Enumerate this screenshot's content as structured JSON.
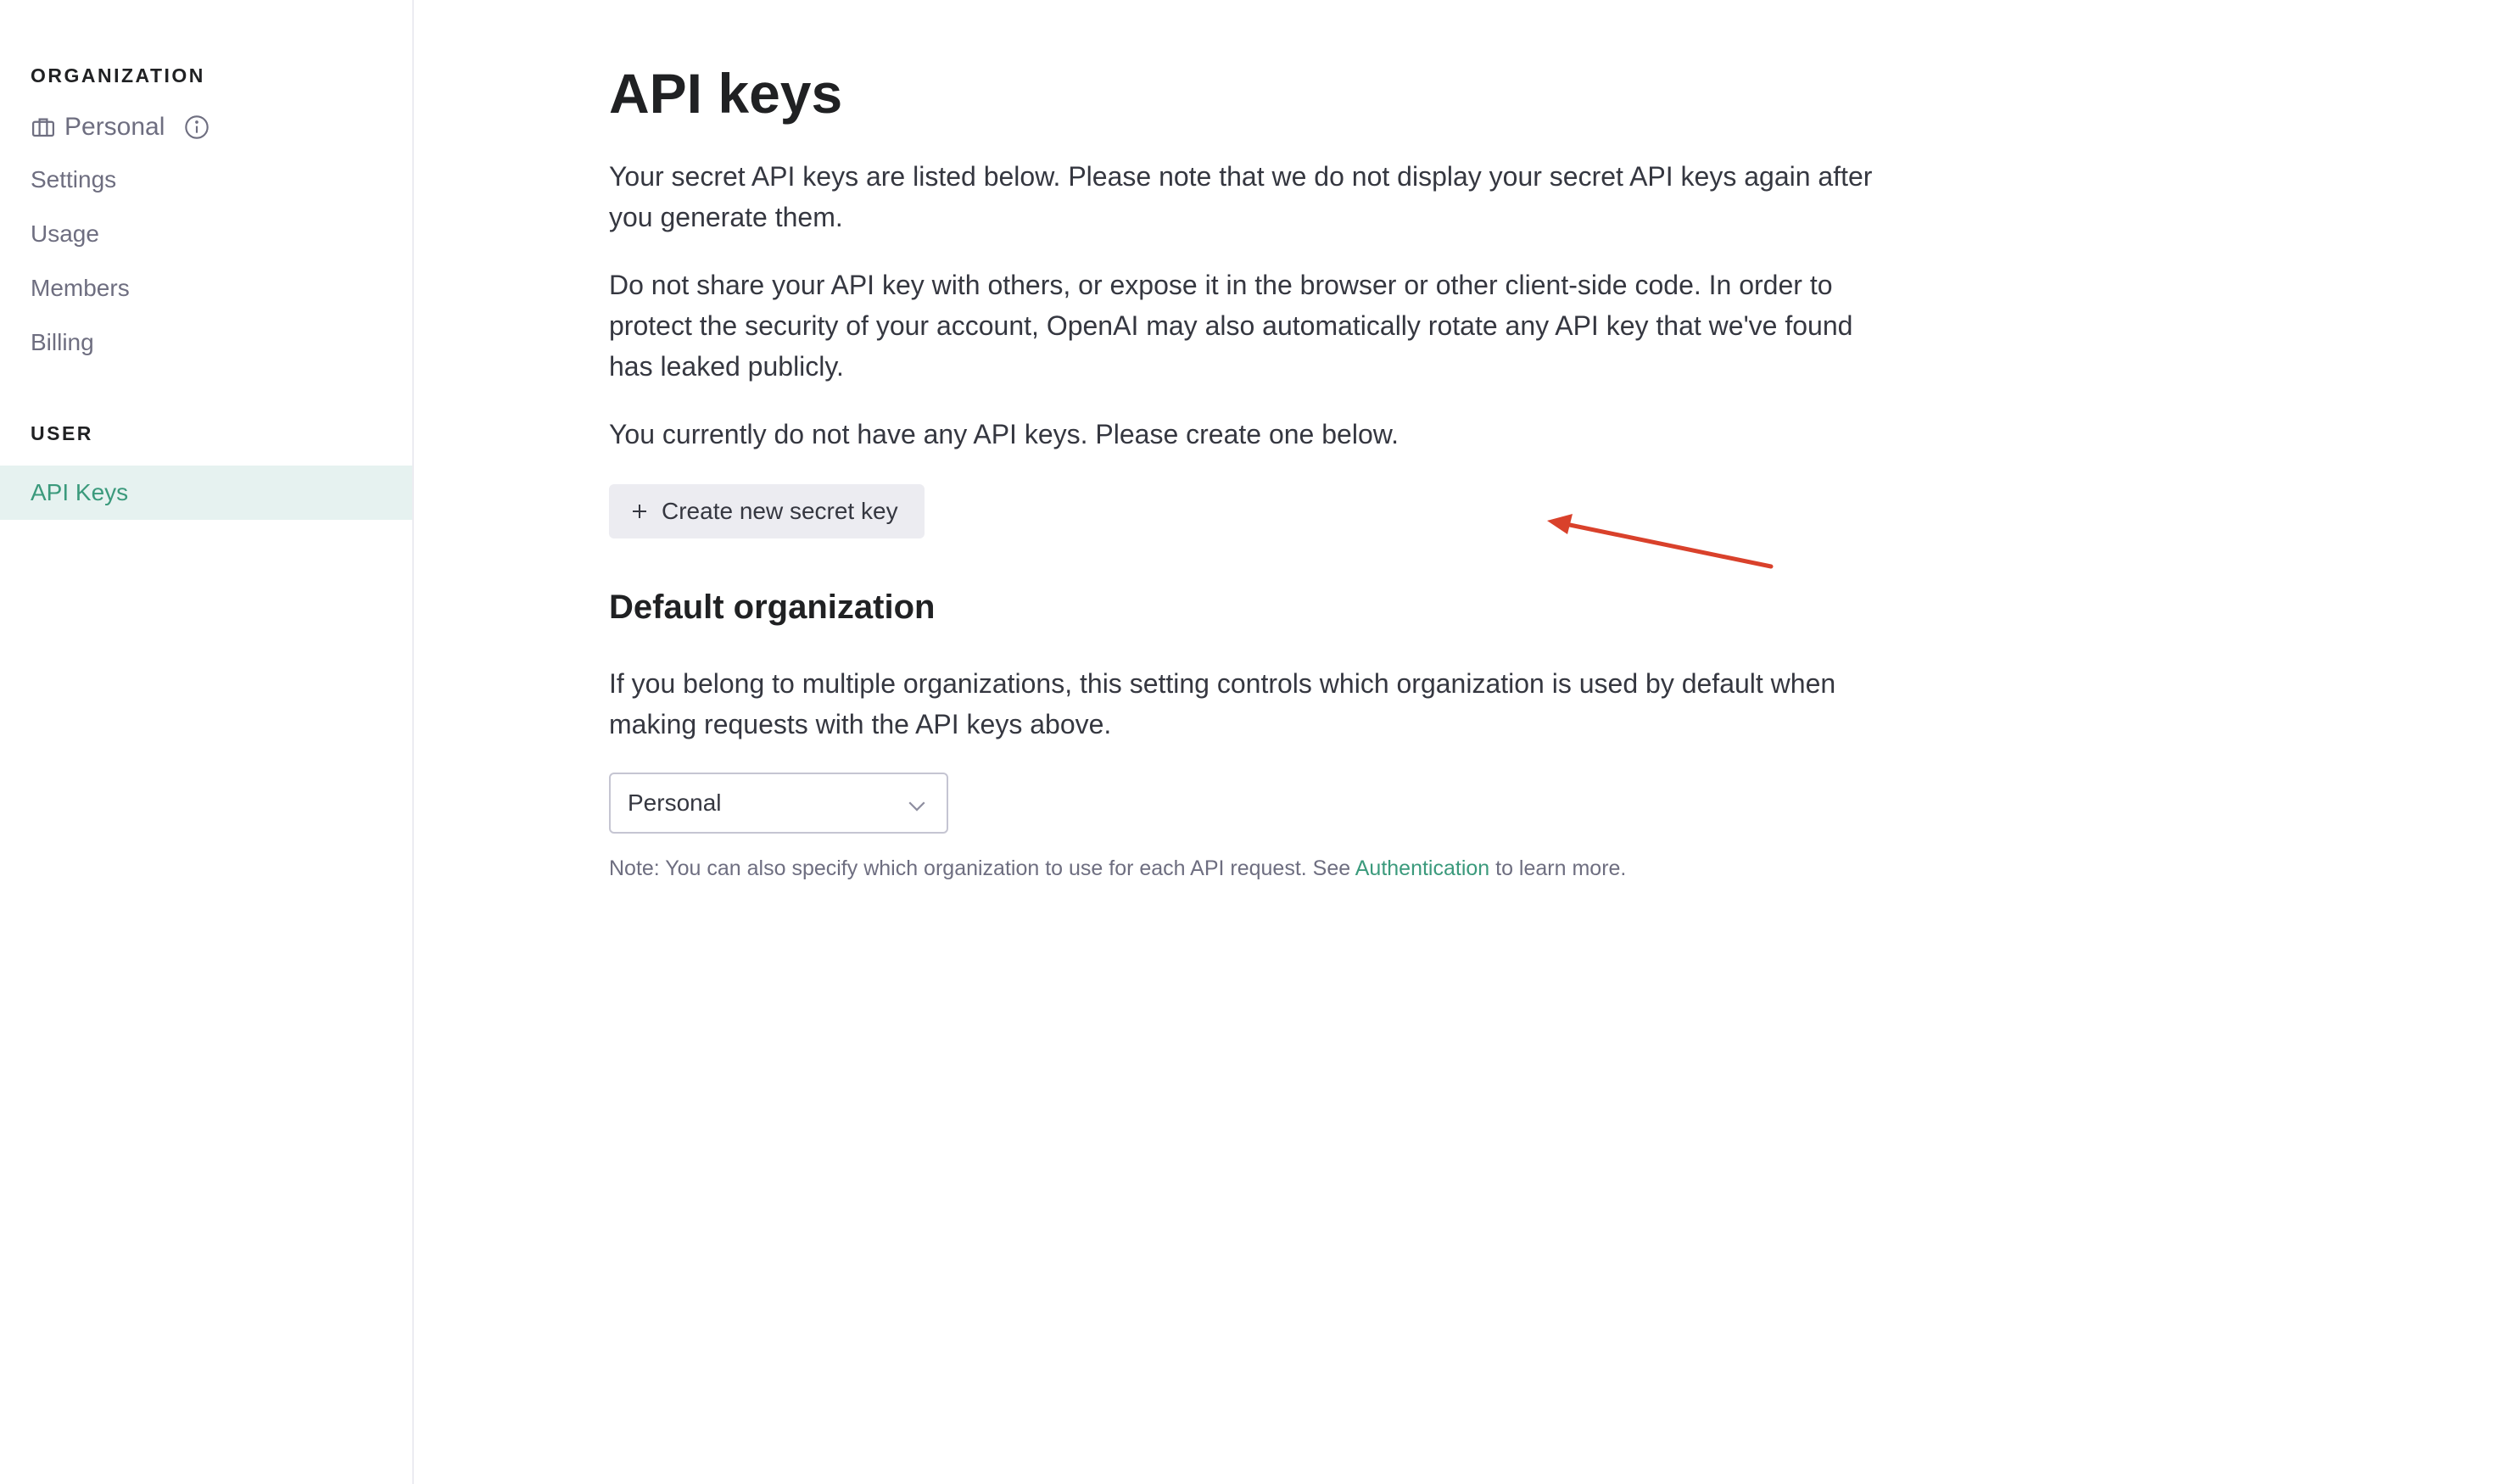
{
  "sidebar": {
    "organization_label": "ORGANIZATION",
    "org_name": "Personal",
    "org_items": [
      {
        "label": "Settings"
      },
      {
        "label": "Usage"
      },
      {
        "label": "Members"
      },
      {
        "label": "Billing"
      }
    ],
    "user_label": "USER",
    "user_items": [
      {
        "label": "API Keys",
        "active": true
      }
    ]
  },
  "main": {
    "title": "API keys",
    "intro": "Your secret API keys are listed below. Please note that we do not display your secret API keys again after you generate them.",
    "warning": "Do not share your API key with others, or expose it in the browser or other client-side code. In order to protect the security of your account, OpenAI may also automatically rotate any API key that we've found has leaked publicly.",
    "empty_state": "You currently do not have any API keys. Please create one below.",
    "create_button_label": "Create new secret key",
    "default_org": {
      "title": "Default organization",
      "description": "If you belong to multiple organizations, this setting controls which organization is used by default when making requests with the API keys above.",
      "selected_value": "Personal",
      "note_prefix": "Note: You can also specify which organization to use for each API request. See ",
      "note_link": "Authentication",
      "note_suffix": " to learn more."
    }
  },
  "colors": {
    "accent": "#3b9a7c",
    "active_bg": "#e6f2f0",
    "button_bg": "#ececf1",
    "annotation_arrow": "#d9412b"
  },
  "icons": {
    "org": "briefcase-icon",
    "org_info": "info-icon",
    "create": "plus-icon",
    "select": "chevron-down-icon"
  }
}
